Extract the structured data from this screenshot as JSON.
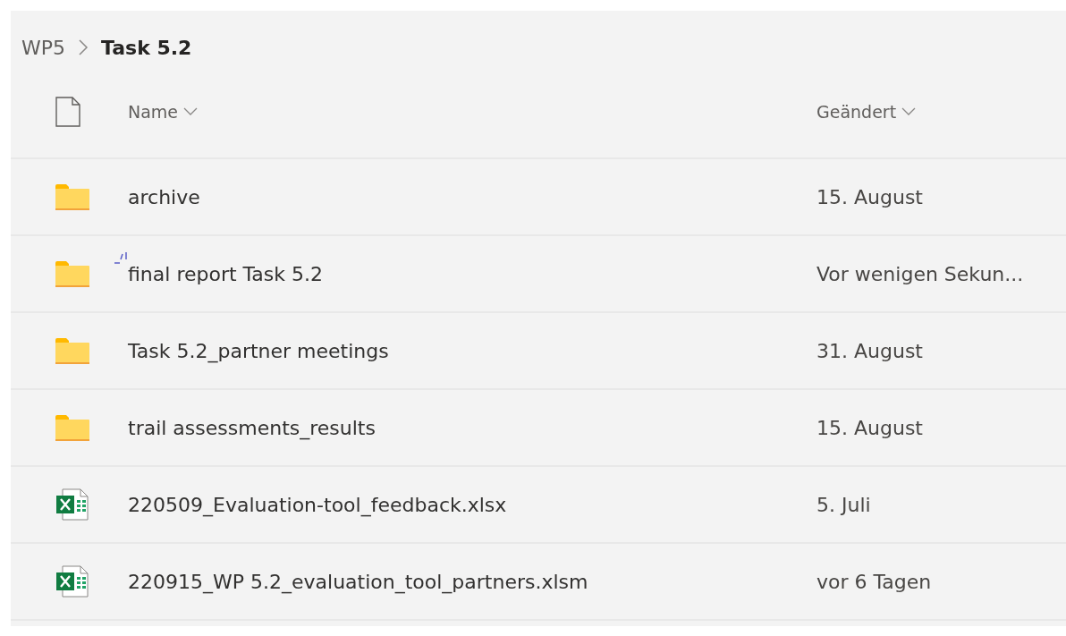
{
  "breadcrumb": {
    "items": [
      {
        "label": "WP5",
        "current": false
      },
      {
        "label": "Task 5.2",
        "current": true
      }
    ]
  },
  "table": {
    "columns": [
      {
        "label": "Name"
      },
      {
        "label": "Geändert"
      }
    ],
    "rows": [
      {
        "kind": "folder",
        "name": "archive",
        "modified": "15. August",
        "is_new": false
      },
      {
        "kind": "folder",
        "name": "final report Task 5.2",
        "modified": "Vor wenigen Sekun...",
        "is_new": true
      },
      {
        "kind": "folder",
        "name": "Task 5.2_partner meetings",
        "modified": "31. August",
        "is_new": false
      },
      {
        "kind": "folder",
        "name": "trail assessments_results",
        "modified": "15. August",
        "is_new": false
      },
      {
        "kind": "excel",
        "name": "220509_Evaluation-tool_feedback.xlsx",
        "modified": "5. Juli",
        "is_new": false
      },
      {
        "kind": "excel",
        "name": "220915_WP 5.2_evaluation_tool_partners.xlsm",
        "modified": "vor 6 Tagen",
        "is_new": false
      }
    ]
  }
}
